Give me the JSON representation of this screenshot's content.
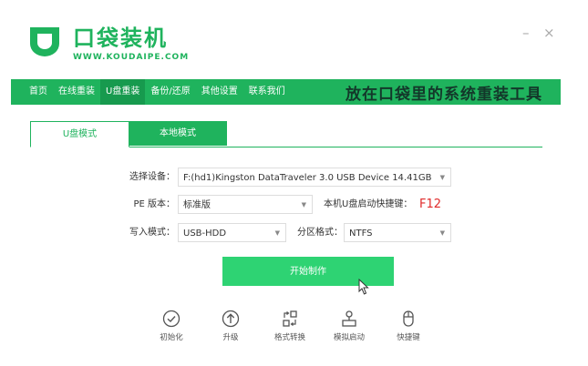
{
  "header": {
    "title": "口袋装机",
    "subtitle": "WWW.KOUDAIPE.COM",
    "minimize": "–",
    "close": "×"
  },
  "nav": {
    "items": [
      {
        "label": "首页"
      },
      {
        "label": "在线重装"
      },
      {
        "label": "U盘重装",
        "active": true
      },
      {
        "label": "备份/还原"
      },
      {
        "label": "其他设置"
      },
      {
        "label": "联系我们"
      }
    ],
    "slogan": "放在口袋里的系统重装工具"
  },
  "tabs": {
    "u_mode": "U盘模式",
    "local_mode": "本地模式"
  },
  "form": {
    "device_label": "选择设备：",
    "device_value": "F:(hd1)Kingston DataTraveler 3.0 USB Device 14.41GB",
    "pe_label": "PE 版本：",
    "pe_value": "标准版",
    "hotkey_label": "本机U盘启动快捷键：",
    "hotkey_value": "F12",
    "write_label": "写入模式：",
    "write_value": "USB-HDD",
    "partition_label": "分区格式：",
    "partition_value": "NTFS"
  },
  "start_button": "开始制作",
  "tools": [
    {
      "label": "初始化",
      "icon": "check-circle-icon"
    },
    {
      "label": "升级",
      "icon": "upgrade-arrow-icon"
    },
    {
      "label": "格式转换",
      "icon": "format-convert-icon"
    },
    {
      "label": "模拟启动",
      "icon": "simulate-boot-icon"
    },
    {
      "label": "快捷键",
      "icon": "mouse-icon"
    }
  ],
  "colors": {
    "brand_green": "#1fb35d",
    "nav_active": "#179a4e",
    "button_green": "#2ed373",
    "hotkey_red": "#e02b2b"
  }
}
